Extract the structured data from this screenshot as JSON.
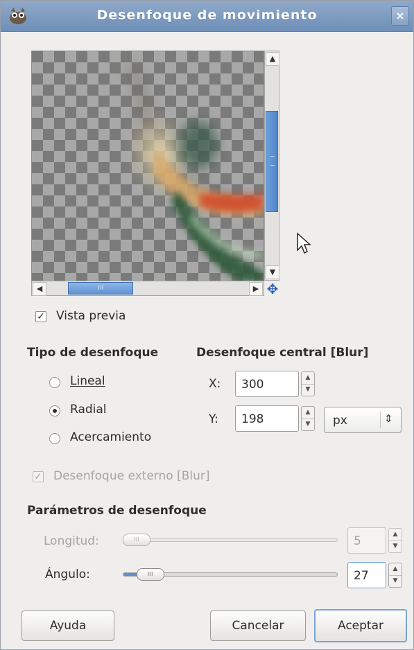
{
  "window": {
    "title": "Desenfoque de movimiento",
    "close_label": "×",
    "app_icon": "gimp-wilber-icon"
  },
  "preview": {
    "enabled_label": "Vista previa",
    "enabled": true,
    "scroll_up": "▲",
    "scroll_down": "▼",
    "scroll_left": "◀",
    "scroll_right": "▶",
    "hthumb_grip": "III",
    "navigate_icon": "✥"
  },
  "blur_type": {
    "heading": "Tipo de desenfoque",
    "options": [
      {
        "label": "Lineal",
        "selected": false
      },
      {
        "label": "Radial",
        "selected": true
      },
      {
        "label": "Acercamiento",
        "selected": false
      }
    ]
  },
  "center": {
    "heading": "Desenfoque central [Blur]",
    "x_label": "X:",
    "x_value": "300",
    "y_label": "Y:",
    "y_value": "198",
    "unit": "px",
    "unit_arrows": "⇕",
    "spin_up": "▲",
    "spin_down": "▼"
  },
  "outward": {
    "label": "Desenfoque externo [Blur]",
    "checked": true,
    "enabled": false
  },
  "params": {
    "heading": "Parámetros de desenfoque",
    "length_label": "Longitud:",
    "length_value": "5",
    "length_fraction": 0.02,
    "angle_label": "Ángulo:",
    "angle_value": "27",
    "angle_fraction": 0.08,
    "handle_grip": "III"
  },
  "buttons": {
    "help": "Ayuda",
    "cancel": "Cancelar",
    "ok": "Aceptar"
  },
  "colors": {
    "accent": "#5b90d0",
    "titlebar": "#7f9cc1"
  }
}
